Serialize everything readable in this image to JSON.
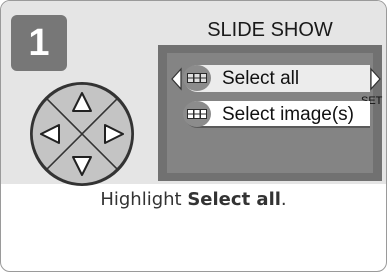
{
  "step": {
    "number": "1"
  },
  "screen": {
    "title": "SLIDE SHOW",
    "set_label": "SET",
    "items": [
      {
        "label": "Select all",
        "icon": "grid-single-row-icon",
        "selected": true
      },
      {
        "label": "Select image(s)",
        "icon": "grid-multi-icon",
        "selected": false
      }
    ]
  },
  "caption": {
    "prefix": "Highlight ",
    "bold": "Select all",
    "suffix": "."
  },
  "colors": {
    "panel_bg": "#e5e5e5",
    "screen_bg": "#717171",
    "step_badge": "#777777",
    "highlight": "#ececec"
  }
}
